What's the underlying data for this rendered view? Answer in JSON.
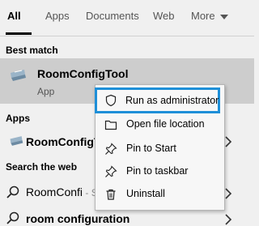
{
  "tabs": {
    "all": "All",
    "apps": "Apps",
    "documents": "Documents",
    "web": "Web",
    "more": "More"
  },
  "best_match": {
    "section": "Best match",
    "title": "RoomConfigTool",
    "subtitle": "App"
  },
  "apps": {
    "section": "Apps",
    "item": "RoomConfigTo"
  },
  "search_web": {
    "section": "Search the web",
    "items": [
      {
        "text": "RoomConfi",
        "suffix": " - Se"
      },
      {
        "text": "room configuration",
        "suffix": ""
      }
    ]
  },
  "context_menu": {
    "items": [
      {
        "label": "Run as administrator",
        "icon": "shield-icon"
      },
      {
        "label": "Open file location",
        "icon": "folder-icon"
      },
      {
        "label": "Pin to Start",
        "icon": "pin-icon"
      },
      {
        "label": "Pin to taskbar",
        "icon": "pin-icon"
      },
      {
        "label": "Uninstall",
        "icon": "trash-icon"
      }
    ]
  },
  "colors": {
    "highlight_border": "#1e8fd8",
    "selected_row": "#cdcdcd",
    "background": "#f0f0f0"
  }
}
